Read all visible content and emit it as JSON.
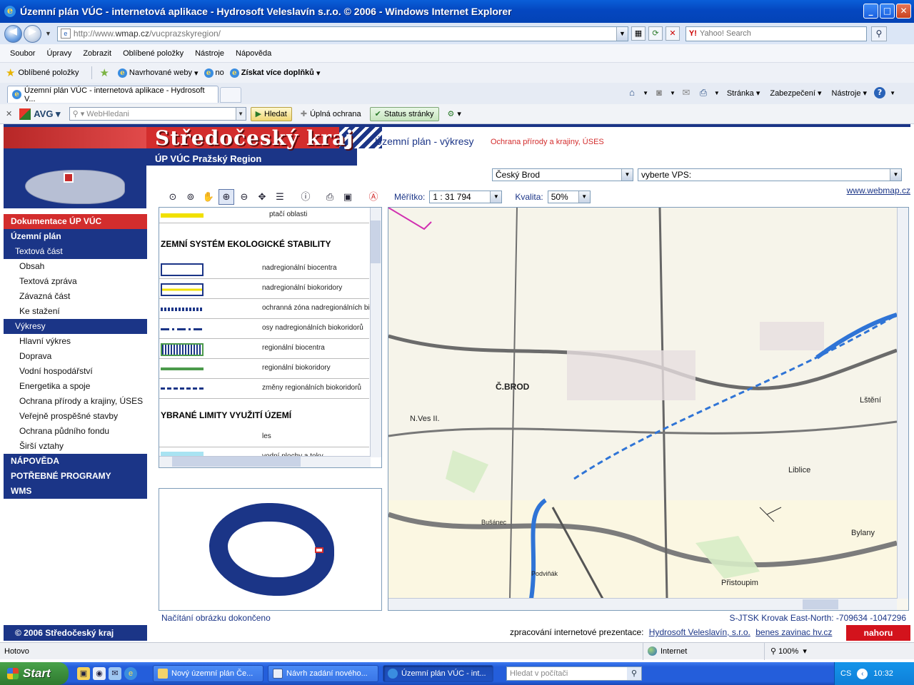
{
  "window": {
    "title": "Územní plán VÚC - internetová aplikace - Hydrosoft Veleslavín s.r.o. © 2006 - Windows Internet Explorer",
    "ie_glyph": "e",
    "min_glyph": "_",
    "max_glyph": "□",
    "close_glyph": "✕"
  },
  "address": {
    "back_glyph": "◀",
    "forward_glyph": "▶",
    "url_prefix": "http://www.",
    "url_domain": "wmap.cz",
    "url_path": "/vucprazskyregion/",
    "search_brand": "Y!",
    "search_placeholder": "Yahoo! Search"
  },
  "menu": [
    "Soubor",
    "Úpravy",
    "Zobrazit",
    "Oblíbené položky",
    "Nástroje",
    "Nápověda"
  ],
  "favorites": {
    "favorites_label": "Oblíbené položky",
    "suggested": "Navrhované weby",
    "no": "no",
    "more_addons": "Získat více doplňků"
  },
  "tab": {
    "title": "Územní plán VÚC - internetová aplikace - Hydrosoft V..."
  },
  "command_bar": {
    "page": "Stránka",
    "security": "Zabezpečení",
    "tools": "Nástroje"
  },
  "avg": {
    "brand": "AVG",
    "search_placeholder": "WebHledani",
    "find": "Hledat",
    "full_protection": "Úplná ochrana",
    "page_status": "Status stránky"
  },
  "page": {
    "header_title": "Středočeský kraj",
    "header_subtitle": "ÚP VÚC  Pražský Region",
    "header_section": "Územní plán - výkresy",
    "header_topic": "Ochrana přírody a krajiny, ÚSES",
    "select_municipality": "Český Brod",
    "select_vps": "vyberte VPS:",
    "scale_label": "Měřítko:",
    "scale_value": "1 : 31 794",
    "quality_label": "Kvalita:",
    "quality_value": "50%",
    "weblink": "www.webmap.cz",
    "nav": {
      "documentation": "Dokumentace ÚP VÚC",
      "plan": "Územní plán",
      "text_part": "Textová část",
      "items_text": [
        "Obsah",
        "Textová zpráva",
        "Závazná část",
        "Ke stažení"
      ],
      "drawings": "Výkresy",
      "items_drawings": [
        "Hlavní výkres",
        "Doprava",
        "Vodní hospodářství",
        "Energetika a spoje",
        "Ochrana přírody a krajiny, ÚSES",
        "Veřejně prospěšné stavby",
        "Ochrana půdního fondu",
        "Širší vztahy"
      ],
      "help": "NÁPOVĚDA",
      "programs": "POTŘEBNÉ PROGRAMY",
      "wms": "WMS"
    },
    "legend": {
      "top_label": "ptačí oblasti",
      "heading1": "ZEMNÍ SYSTÉM EKOLOGICKÉ STABILITY",
      "rows1": [
        "nadregionální biocentra",
        "nadregionální biokoridory",
        "ochranná zóna nadregionálních biokoridorů",
        "osy nadregionálních biokoridorů",
        "regionální biocentra",
        "regionální biokoridory",
        "změny regionálních biokoridorů"
      ],
      "heading2": "YBRANÉ LIMITY VYUŽITÍ ÚZEMÍ",
      "rows2": [
        "les",
        "vodní plochy a toky"
      ]
    },
    "map_labels": {
      "brod": "Č.BROD",
      "nves": "N.Ves II.",
      "liblice": "Liblice",
      "bylany": "Bylany",
      "pristoupim": "Přistoupim",
      "lstiboi": "Lštění",
      "podvinak": "Podviňák",
      "busanec": "Bušánec"
    },
    "status": "Načítání obrázku dokončeno",
    "coords": "S-JTSK Krovak East-North: -709634 -1047296",
    "credits_label": "zpracování internetové prezentace:",
    "credits_link1": "Hydrosoft Veleslavín, s.r.o.",
    "credits_link2": "benes zavinac hv.cz",
    "copyright": "© 2006 Středočeský kraj",
    "top_button": "nahoru"
  },
  "statusbar": {
    "ready": "Hotovo",
    "zone": "Internet",
    "zoom": "100%"
  },
  "taskbar": {
    "start": "Start",
    "tasks": [
      "Nový územní plán Če...",
      "Návrh zadání nového...",
      "Územní plán VÚC - int..."
    ],
    "search_placeholder": "Hledat v počítači",
    "lang": "CS",
    "time": "10:32"
  },
  "colors": {
    "brand_blue": "#1b3587",
    "brand_red": "#d32d2d",
    "taskbar_blue": "#245edb"
  }
}
